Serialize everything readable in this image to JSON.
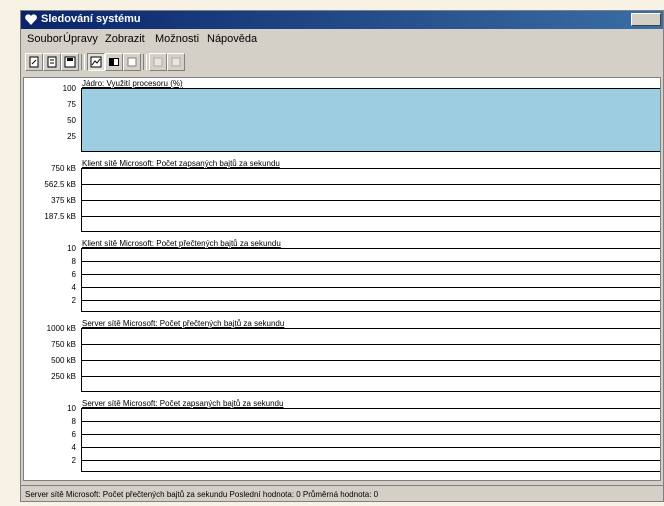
{
  "window": {
    "title": "Sledování systému"
  },
  "menubar": {
    "items": [
      "Soubor",
      "Úpravy",
      "Zobrazit",
      "Možnosti",
      "Nápověda"
    ]
  },
  "toolbar": {
    "buttons": [
      {
        "icon": "new-chart-icon"
      },
      {
        "icon": "open-icon"
      },
      {
        "icon": "save-icon"
      },
      {
        "icon": "chart-view-icon",
        "pressed": true
      },
      {
        "icon": "alert-view-icon"
      },
      {
        "icon": "log-view-icon"
      },
      {
        "icon": "add-counter-icon",
        "disabled": true
      },
      {
        "icon": "remove-counter-icon",
        "disabled": true
      }
    ]
  },
  "graphs": [
    {
      "title": "Jádro: Využití procesoru (%)",
      "y_ticks": [
        "100",
        "75",
        "50",
        "25"
      ],
      "fill_percent": 100,
      "fill_color": "#9ccde0"
    },
    {
      "title": "Klient sítě Microsoft: Počet zapsaných bajtů za sekundu",
      "y_ticks": [
        "750 kB",
        "562.5 kB",
        "375 kB",
        "187.5 kB"
      ],
      "fill_percent": 0
    },
    {
      "title": "Klient sítě Microsoft: Počet přečtených bajtů za sekundu",
      "y_ticks": [
        "10",
        "8",
        "6",
        "4",
        "2"
      ],
      "fill_percent": 0
    },
    {
      "title": "Server sítě Microsoft: Počet přečtených bajtů za sekundu",
      "y_ticks": [
        "1000 kB",
        "750 kB",
        "500 kB",
        "250 kB"
      ],
      "fill_percent": 0
    },
    {
      "title": "Server sítě Microsoft: Počet zapsaných bajtů za sekundu",
      "y_ticks": [
        "10",
        "8",
        "6",
        "4",
        "2"
      ],
      "fill_percent": 0
    }
  ],
  "status": {
    "text": "Server sítě Microsoft: Počet přečtených bajtů za sekundu  Poslední hodnota: 0  Průměrná hodnota: 0"
  }
}
